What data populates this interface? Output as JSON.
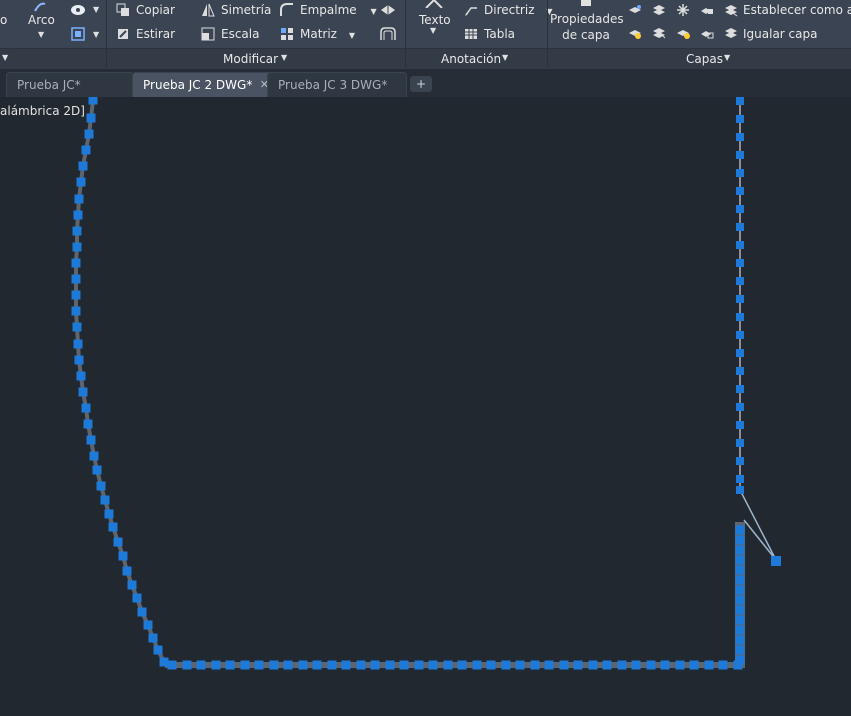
{
  "ribbon": {
    "draw_panel": {
      "arc_label": "Arco",
      "cut_label": "o"
    },
    "modify_panel": {
      "title": "Modificar",
      "copy": "Copiar",
      "stretch": "Estirar",
      "mirror": "Simetría",
      "scale": "Escala",
      "fillet": "Empalme",
      "array": "Matriz"
    },
    "annotation_panel": {
      "title": "Anotación",
      "text": "Texto",
      "leader": "Directriz",
      "table": "Tabla"
    },
    "layers_panel": {
      "title": "Capas",
      "properties": "Propiedades de capa",
      "properties_line1": "Propiedades",
      "properties_line2": "de capa",
      "set_current": "Establecer como actual",
      "match": "Igualar capa"
    }
  },
  "tabs": [
    {
      "label": "Prueba JC*",
      "active": false
    },
    {
      "label": "Prueba JC 2 DWG*",
      "active": true
    },
    {
      "label": "Prueba JC 3 DWG*",
      "active": false
    }
  ],
  "viewport": {
    "label": "alámbrica 2D]",
    "background": "#212830",
    "grip_color": "#1e7ad9",
    "line_color": "#8a8f96"
  }
}
